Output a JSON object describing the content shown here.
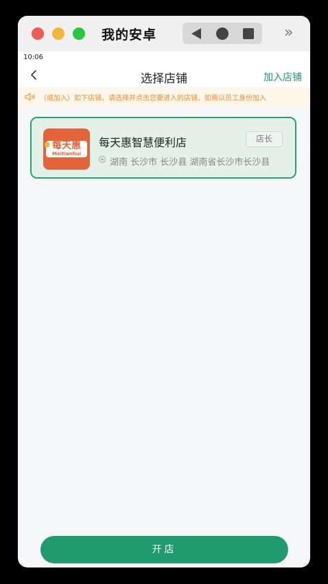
{
  "window": {
    "title": "我的安卓",
    "more_label": "»"
  },
  "status": {
    "time": "10:06"
  },
  "nav": {
    "title": "选择店铺",
    "action": "加入店铺"
  },
  "notice": {
    "text": "（或加入）如下店铺，请选择并点击您要进入的店铺，如需以员工身份加入"
  },
  "stores": [
    {
      "name": "每天惠智慧便利店",
      "role": "店长",
      "address": "湖南 长沙市 长沙县 湖南省长沙市长沙县",
      "logo_cn": "每天惠",
      "logo_en": "Meitianhui"
    }
  ],
  "footer": {
    "open_label": "开店"
  },
  "colors": {
    "accent": "#1f9b6e",
    "card_bg": "#e4f1e9",
    "notice_text": "#f08c2c",
    "logo_bg": "#e4643a"
  }
}
